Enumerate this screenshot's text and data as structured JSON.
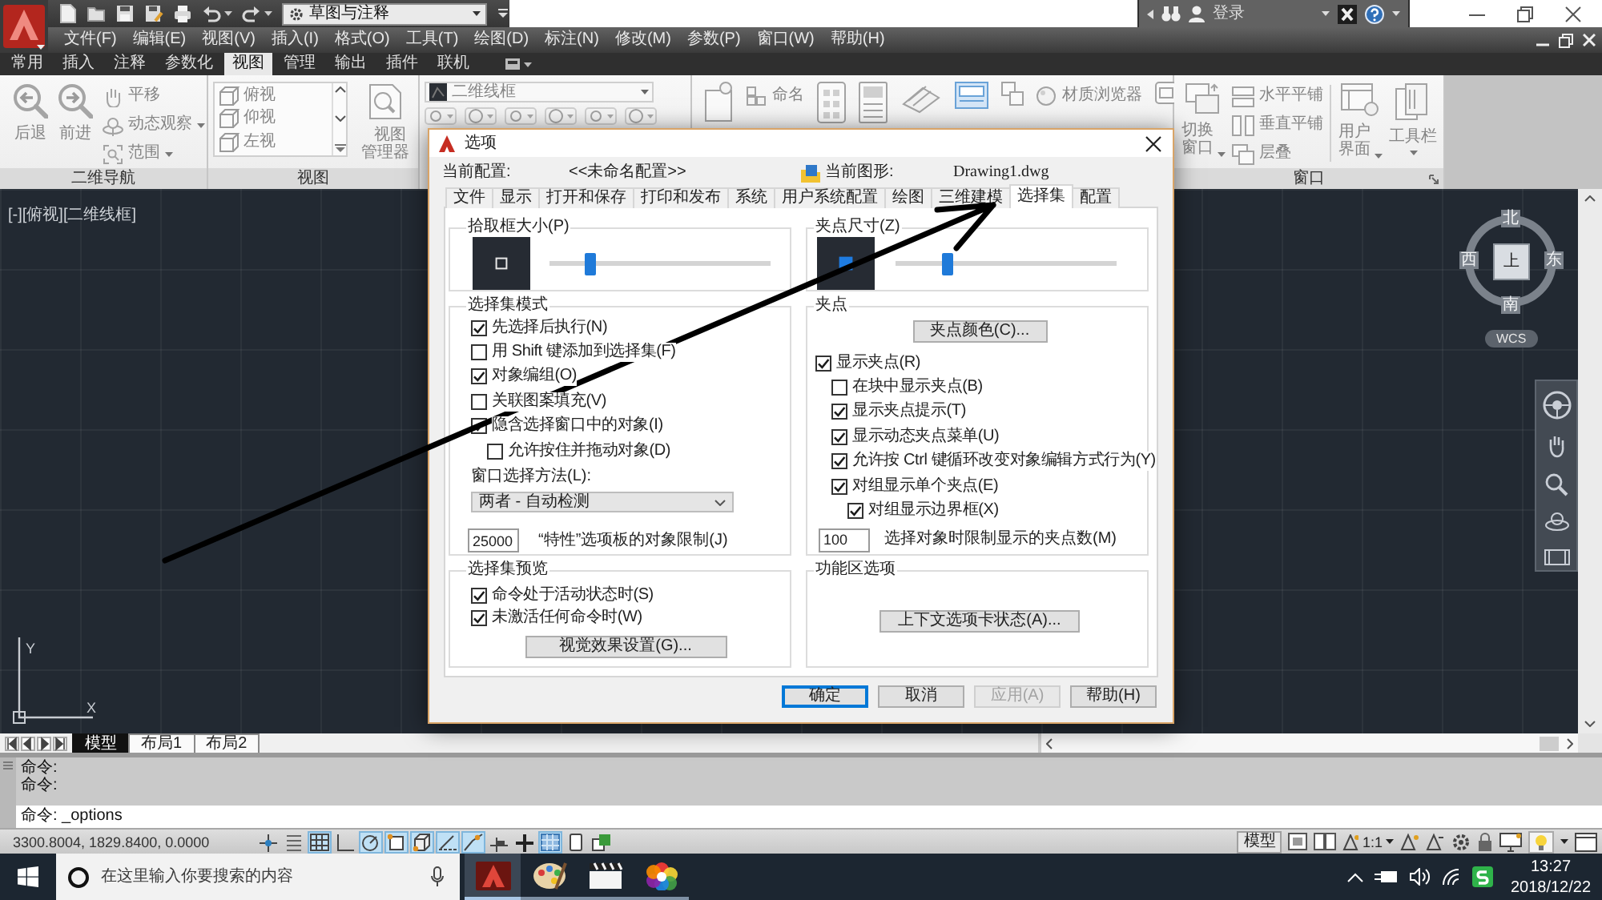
{
  "title_bar": {
    "workspace": "草图与注释",
    "sign_in": "登录"
  },
  "menu_bar": [
    "文件(F)",
    "编辑(E)",
    "视图(V)",
    "插入(I)",
    "格式(O)",
    "工具(T)",
    "绘图(D)",
    "标注(N)",
    "修改(M)",
    "参数(P)",
    "窗口(W)",
    "帮助(H)"
  ],
  "ribbon": {
    "tabs": [
      {
        "label": "常用",
        "selected": false
      },
      {
        "label": "插入",
        "selected": false
      },
      {
        "label": "注释",
        "selected": false
      },
      {
        "label": "参数化",
        "selected": false
      },
      {
        "label": "视图",
        "selected": true
      },
      {
        "label": "管理",
        "selected": false
      },
      {
        "label": "输出",
        "selected": false
      },
      {
        "label": "插件",
        "selected": false
      },
      {
        "label": "联机",
        "selected": false
      }
    ],
    "navigation_panel": {
      "title": "二维导航",
      "large_buttons": [
        "后退",
        "前进"
      ],
      "small_buttons": [
        {
          "label": "平移",
          "dropdown": false
        },
        {
          "label": "动态观察",
          "dropdown": true
        },
        {
          "label": "范围",
          "dropdown": true
        }
      ]
    },
    "views_panel": {
      "title": "视图",
      "views": [
        "俯视",
        "仰视",
        "左视"
      ],
      "manager_button": "视图管理器"
    },
    "visual_styles_panel": {
      "style": "二维线框"
    },
    "palettes_panel": {
      "named_button": "命名",
      "material_button": "材质浏览器"
    },
    "window_panel": {
      "title": "窗口",
      "switch_button": {
        "label": "切换窗口",
        "dropdown": true
      },
      "tile_buttons": [
        "水平平铺",
        "垂直平铺",
        "层叠"
      ],
      "ui_buttons": [
        {
          "label": "用户界面",
          "dropdown": true
        },
        {
          "label": "工具栏",
          "dropdown": true
        }
      ]
    }
  },
  "viewport": {
    "label": "[-][俯视][二维线框]",
    "viewcube": {
      "north": "北",
      "west": "西",
      "east": "东",
      "south": "南",
      "face": "上"
    },
    "ucs_button": "WCS",
    "axes": {
      "x": "X",
      "y": "Y"
    }
  },
  "layout_tabs": [
    {
      "label": "模型",
      "selected": true
    },
    {
      "label": "布局1",
      "selected": false
    },
    {
      "label": "布局2",
      "selected": false
    }
  ],
  "command_window": {
    "history": [
      "命令:",
      "命令:"
    ],
    "input": "命令: _options"
  },
  "status_bar": {
    "coordinates": "3300.8004, 1829.8400, 0.0000",
    "toggles": [
      {
        "on": false
      },
      {
        "on": false
      },
      {
        "on": true
      },
      {
        "on": false
      },
      {
        "on": true
      },
      {
        "on": true
      },
      {
        "on": true
      },
      {
        "on": true
      },
      {
        "on": true
      },
      {
        "on": false
      },
      {
        "on": false
      },
      {
        "on": true
      },
      {
        "on": false
      },
      {
        "on": false
      }
    ],
    "space": "模型",
    "annotation_scale": "1:1"
  },
  "taskbar": {
    "search": {
      "placeholder": "在这里输入你要搜索的内容"
    },
    "apps": [
      {
        "active": true
      },
      {
        "active": false
      },
      {
        "active": false
      },
      {
        "active": false
      }
    ],
    "clock": {
      "time": "13:27",
      "date": "2018/12/22"
    }
  },
  "options_dialog": {
    "title": "选项",
    "current_profile_label": "当前配置:",
    "current_profile": "<<未命名配置>>",
    "current_drawing_label": "当前图形:",
    "current_drawing": "Drawing1.dwg",
    "tabs": [
      {
        "label": "文件",
        "selected": false
      },
      {
        "label": "显示",
        "selected": false
      },
      {
        "label": "打开和保存",
        "selected": false
      },
      {
        "label": "打印和发布",
        "selected": false
      },
      {
        "label": "系统",
        "selected": false
      },
      {
        "label": "用户系统配置",
        "selected": false
      },
      {
        "label": "绘图",
        "selected": false
      },
      {
        "label": "三维建模",
        "selected": false
      },
      {
        "label": "选择集",
        "selected": true
      },
      {
        "label": "配置",
        "selected": false
      }
    ],
    "pickbox": {
      "title": "拾取框大小(P)",
      "level": 0.17
    },
    "selection_modes": {
      "title": "选择集模式",
      "options": [
        {
          "label": "先选择后执行(N)",
          "checked": true
        },
        {
          "label": "用 Shift 键添加到选择集(F)",
          "checked": false
        },
        {
          "label": "对象编组(O)",
          "checked": true
        },
        {
          "label": "关联图案填充(V)",
          "checked": false
        },
        {
          "label": "隐含选择窗口中的对象(I)",
          "checked": true,
          "children": [
            {
              "label": "允许按住并拖动对象(D)",
              "checked": false
            }
          ]
        }
      ]
    },
    "window_selection_method": {
      "label": "窗口选择方法(L):",
      "value": "两者 - 自动检测"
    },
    "object_limit": {
      "value": "25000",
      "label": "“特性”选项板的对象限制(J)"
    },
    "selection_preview": {
      "title": "选择集预览",
      "options": [
        {
          "label": "命令处于活动状态时(S)",
          "checked": true
        },
        {
          "label": "未激活任何命令时(W)",
          "checked": true
        }
      ],
      "button": "视觉效果设置(G)..."
    },
    "grip_size": {
      "title": "夹点尺寸(Z)",
      "level": 0.22
    },
    "grips": {
      "title": "夹点",
      "color_button": "夹点颜色(C)...",
      "options": [
        {
          "label": "显示夹点(R)",
          "checked": true,
          "children": [
            {
              "label": "在块中显示夹点(B)",
              "checked": false
            },
            {
              "label": "显示夹点提示(T)",
              "checked": true
            },
            {
              "label": "显示动态夹点菜单(U)",
              "checked": true
            },
            {
              "label": "允许按 Ctrl 键循环改变对象编辑方式行为(Y)",
              "checked": true
            },
            {
              "label": "对组显示单个夹点(E)",
              "checked": true,
              "children": [
                {
                  "label": "对组显示边界框(X)",
                  "checked": true
                }
              ]
            }
          ]
        }
      ],
      "limit": {
        "value": "100",
        "label": "选择对象时限制显示的夹点数(M)"
      }
    },
    "ribbon_options": {
      "title": "功能区选项",
      "button": "上下文选项卡状态(A)..."
    },
    "buttons": [
      {
        "label": "确定",
        "default": true,
        "disabled": false
      },
      {
        "label": "取消",
        "default": false,
        "disabled": false
      },
      {
        "label": "应用(A)",
        "default": false,
        "disabled": true
      },
      {
        "label": "帮助(H)",
        "default": false,
        "disabled": false
      }
    ]
  }
}
